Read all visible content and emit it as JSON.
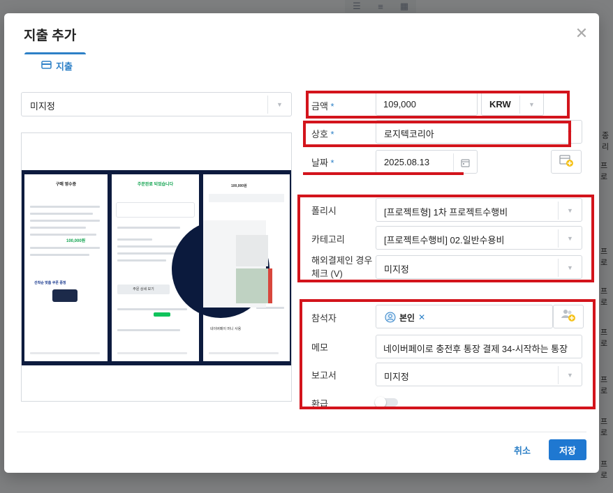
{
  "modal": {
    "title": "지출 추가",
    "tab_label": "지출",
    "cancel_label": "취소",
    "save_label": "저장"
  },
  "left": {
    "category_select_value": "미지정"
  },
  "receipt_preview": {
    "phone1_title": "구매 영수증",
    "phone1_amount": "100,000원",
    "phone1_promo": "선착순 맞춤 쿠폰 증정",
    "phone2_title": "주문완료 되었습니다",
    "phone2_button": "주문 상세 보기",
    "phone3_amount": "100,000원",
    "phone3_label": "네이버페이 머니 사용"
  },
  "form": {
    "amount_label": "금액",
    "amount_value": "109,000",
    "currency_value": "KRW",
    "merchant_label": "상호",
    "merchant_value": "로지텍코리아",
    "date_label": "날짜",
    "date_value": "2025.08.13",
    "policy_label": "폴리시",
    "policy_value": "[프로젝트형] 1차 프로젝트수행비",
    "category_label": "카테고리",
    "category_value": "[프로젝트수행비] 02.일반수용비",
    "overseas_label_line1": "해외결제인 경우",
    "overseas_label_line2": "체크 (V)",
    "overseas_value": "미지정",
    "attendee_label": "참석자",
    "attendee_chip": "본인",
    "memo_label": "메모",
    "memo_value": "네이버페이로 충전후 통장 결제 34-시작하는 통장",
    "report_label": "보고서",
    "report_value": "미지정",
    "refund_label": "환급",
    "required_mark": "*"
  },
  "background": {
    "right_cell": "프로",
    "right_edge_top": "종리"
  },
  "colors": {
    "accent": "#2d80c7",
    "primary_button": "#1f78d1",
    "annotation_red": "#d3141c"
  }
}
